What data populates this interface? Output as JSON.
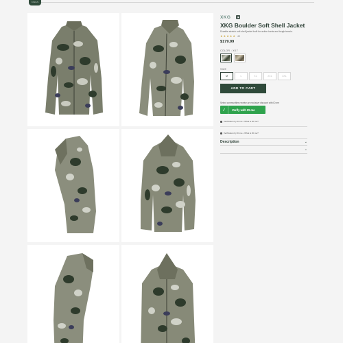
{
  "header": {
    "logo_text": "KINGS"
  },
  "gallery": {
    "images": [
      {
        "name": "front view"
      },
      {
        "name": "front three-quarter view"
      },
      {
        "name": "right side view"
      },
      {
        "name": "back view"
      },
      {
        "name": "left side view"
      },
      {
        "name": "front hood view"
      }
    ]
  },
  "product": {
    "brand": "XKG",
    "title": "XKG Boulder Soft Shell Jacket",
    "subtitle": "Durable stretch soft shell jacket built for active hunts and tough terrain.",
    "stars": [
      "★",
      "★",
      "★",
      "★",
      "★"
    ],
    "rating_count": "49",
    "price": "$179.99",
    "color_label": "COLOR : XK7",
    "swatches": [
      {
        "name": "XK7",
        "selected": true,
        "color": "#8f9482"
      },
      {
        "name": "XK7 alt",
        "selected": false,
        "color": "#a39a86"
      }
    ],
    "size_label": "SIZE",
    "sizes": [
      {
        "label": "M",
        "selected": true
      },
      {
        "label": "L",
        "selected": false
      },
      {
        "label": "XL",
        "selected": false
      },
      {
        "label": "2XL",
        "selected": false
      },
      {
        "label": "3XL",
        "selected": false
      }
    ],
    "add_to_cart": "ADD TO CART",
    "discount_note": "Select communities receive an exclusive discount with ID.me",
    "verify_button": "Verify with ID.me",
    "verification_lines": [
      "Verification by ID.me • What is ID.me?",
      "Verification by ID.me • What is ID.me?"
    ],
    "accordion": [
      {
        "title": "Description"
      },
      {
        "title": ""
      }
    ]
  },
  "colors": {
    "brand_green": "#2f4a3a",
    "verify_green": "#2fa34d",
    "brand_teal": "#6f8f86"
  }
}
